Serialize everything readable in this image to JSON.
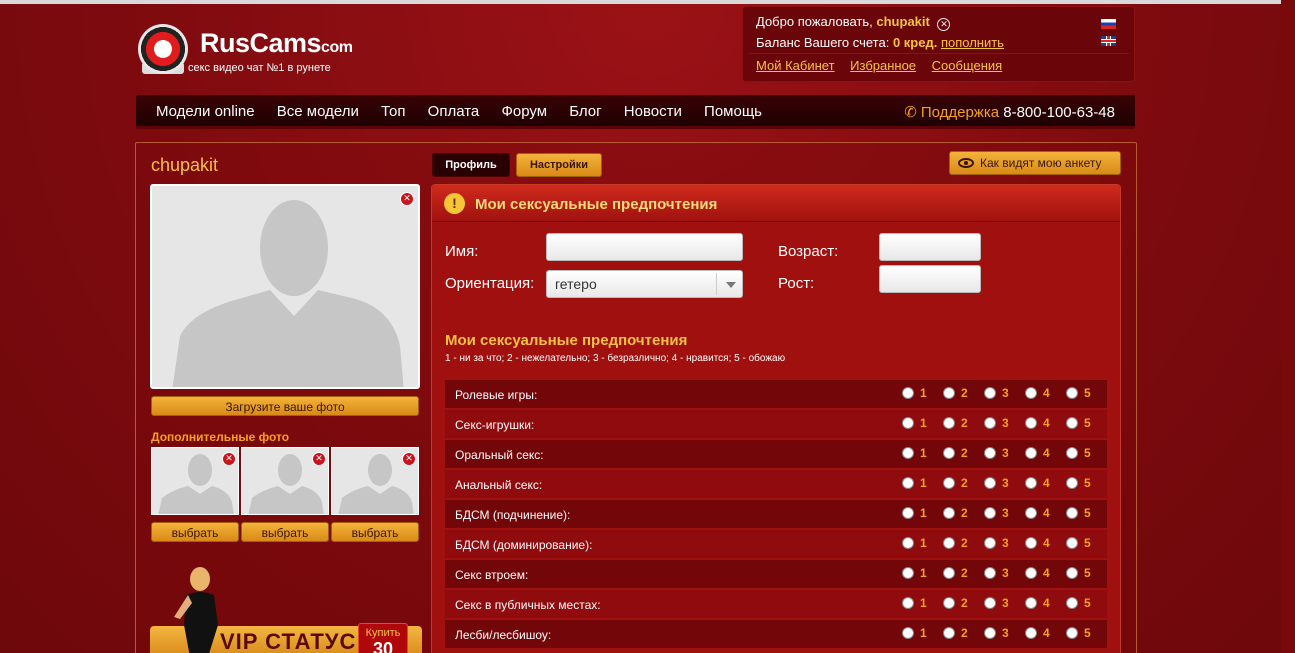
{
  "header": {
    "brand": "RusCams",
    "brand_suffix": "com",
    "tagline": "секс видео чат №1 в рунете",
    "welcome": "Добро пожаловать,",
    "username": "chupakit",
    "balance_label": "Баланс Вашего счета:",
    "balance_value": "0 кред.",
    "topup": "пополнить",
    "links": [
      "Мой Кабинет",
      "Избранное",
      "Сообщения"
    ]
  },
  "nav": {
    "items": [
      "Модели online",
      "Все модели",
      "Топ",
      "Оплата",
      "Форум",
      "Блог",
      "Новости",
      "Помощь"
    ],
    "support_label": "Поддержка",
    "support_phone": "8-800-100-63-48"
  },
  "profile": {
    "username": "chupakit",
    "upload_button": "Загрузите ваше фото",
    "extra_photos_label": "Дополнительные фото",
    "select_label": "выбрать",
    "vip_text": "VIP СТАТУС",
    "vip_buy": "Купить",
    "vip_price": "30"
  },
  "tabs": {
    "profile": "Профиль",
    "settings": "Настройки",
    "view_button": "Как видят мою анкету"
  },
  "panel": {
    "title": "Мои сексуальные предпочтения",
    "name_label": "Имя:",
    "name_value": "",
    "age_label": "Возраст:",
    "age_value": "",
    "orientation_label": "Ориентация:",
    "orientation_value": "гетеро",
    "height_label": "Рост:",
    "height_value": "",
    "prefs_title": "Мои сексуальные предпочтения",
    "prefs_legend": "1 - ни за что; 2 - нежелательно; 3 - безразлично; 4 - нравится; 5 - обожаю",
    "rating_options": [
      "1",
      "2",
      "3",
      "4",
      "5"
    ],
    "rows": [
      "Ролевые игры:",
      "Секс-игрушки:",
      "Оральный секс:",
      "Анальный секс:",
      "БДСМ (подчинение):",
      "БДСМ (доминирование):",
      "Секс втроем:",
      "Секс в публичных местах:",
      "Лесби/лесбишоу:"
    ]
  }
}
